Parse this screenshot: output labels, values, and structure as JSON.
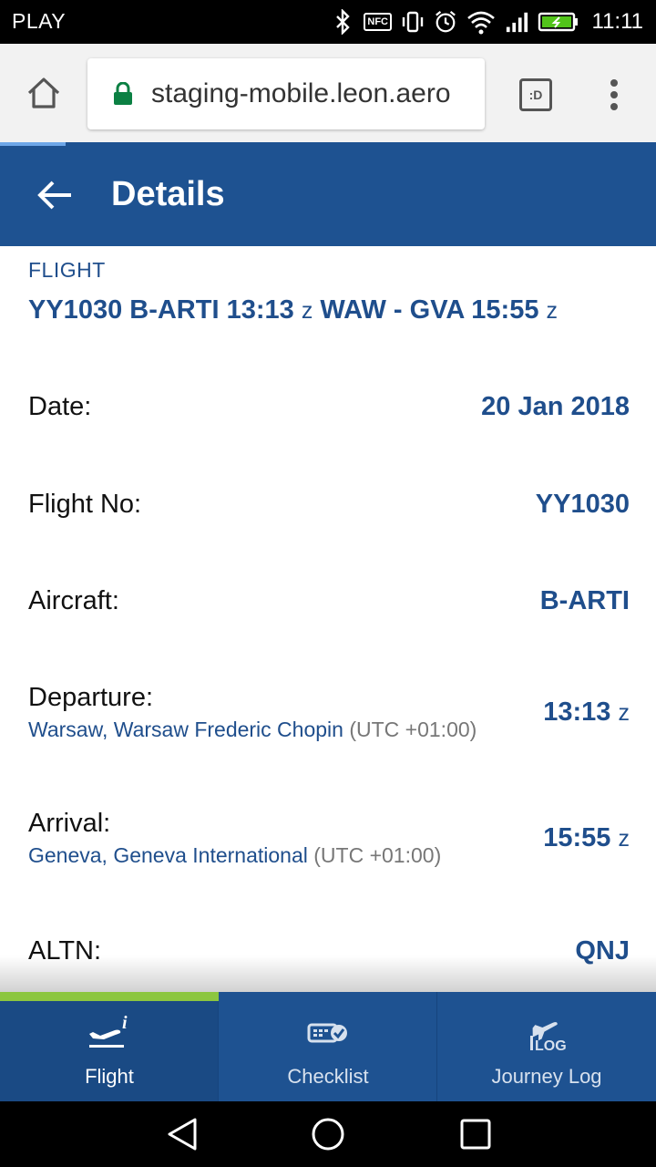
{
  "status_bar": {
    "carrier": "PLAY",
    "nfc": "NFC",
    "time": "11:11",
    "icons": [
      "bluetooth-icon",
      "nfc-icon",
      "vibrate-icon",
      "alarm-icon",
      "wifi-icon",
      "signal-icon",
      "battery-icon"
    ]
  },
  "browser": {
    "url": "staging-mobile.leon.aero",
    "tab_label": ":D",
    "load_progress_percent": 10
  },
  "header": {
    "title": "Details"
  },
  "flight": {
    "section_label": "FLIGHT",
    "summary": {
      "part1": "YY1030 B-ARTI 13:13",
      "z1": "z",
      "part2": "WAW - GVA 15:55",
      "z2": "z"
    },
    "rows": {
      "date": {
        "label": "Date:",
        "value": "20 Jan 2018"
      },
      "flight_no": {
        "label": "Flight No:",
        "value": "YY1030"
      },
      "aircraft": {
        "label": "Aircraft:",
        "value": "B-ARTI"
      },
      "departure": {
        "label": "Departure:",
        "airport": "Warsaw, Warsaw Frederic Chopin",
        "tz": "(UTC +01:00)",
        "time": "13:13",
        "z": "z"
      },
      "arrival": {
        "label": "Arrival:",
        "airport": "Geneva, Geneva International",
        "tz": "(UTC +01:00)",
        "time": "15:55",
        "z": "z"
      },
      "altn": {
        "label": "ALTN:",
        "value": "QNJ"
      }
    }
  },
  "bottom_nav": {
    "items": [
      {
        "label": "Flight",
        "icon": "flight-info-icon",
        "active": true
      },
      {
        "label": "Checklist",
        "icon": "checklist-icon",
        "active": false
      },
      {
        "label": "Journey Log",
        "icon": "journey-log-icon",
        "active": false
      }
    ]
  },
  "colors": {
    "primary": "#1e5291",
    "accent": "#8cc63f",
    "text_blue": "#1f4e8c"
  }
}
